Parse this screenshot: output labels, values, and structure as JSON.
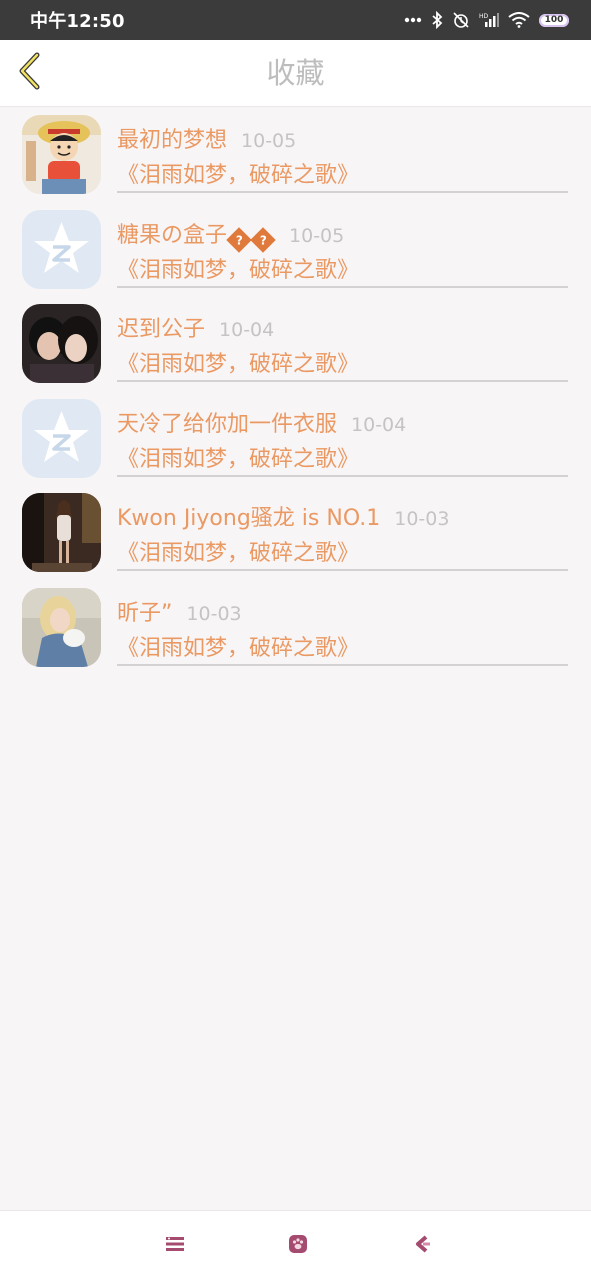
{
  "status_bar": {
    "time": "中午12:50",
    "battery": "100",
    "icons": [
      "more-dots-icon",
      "bluetooth-icon",
      "alarm-off-icon",
      "hd-signal-icon",
      "wifi-icon",
      "battery-icon"
    ]
  },
  "header": {
    "title": "收藏",
    "back_icon": "chevron-left-icon"
  },
  "favorites": [
    {
      "user": "最初的梦想",
      "date": "10-05",
      "song": "《泪雨如梦，破碎之歌》",
      "avatar": "cartoon-avatar"
    },
    {
      "user": "糖果の盒子",
      "suffix": "??",
      "date": "10-05",
      "song": "《泪雨如梦，破碎之歌》",
      "avatar": "default-qzone-avatar"
    },
    {
      "user": "迟到公子",
      "date": "10-04",
      "song": "《泪雨如梦，破碎之歌》",
      "avatar": "couple-photo-avatar"
    },
    {
      "user": "天冷了给你加一件衣服",
      "date": "10-04",
      "song": "《泪雨如梦，破碎之歌》",
      "avatar": "default-qzone-avatar"
    },
    {
      "user": "Kwon Jiyong骚龙 is NO.1",
      "date": "10-03",
      "song": "《泪雨如梦，破碎之歌》",
      "avatar": "person-photo-avatar"
    },
    {
      "user": "昕子”",
      "date": "10-03",
      "song": "《泪雨如梦，破碎之歌》",
      "avatar": "blonde-photo-avatar"
    }
  ],
  "bottom_nav": [
    "menu-list-icon",
    "paw-icon",
    "back-arrow-icon"
  ],
  "colors": {
    "accent": "#ea9963",
    "date": "#c4c4c4",
    "title": "#bdbdbd",
    "nav_icon": "#a44b6f",
    "background": "#f8f5f7"
  }
}
